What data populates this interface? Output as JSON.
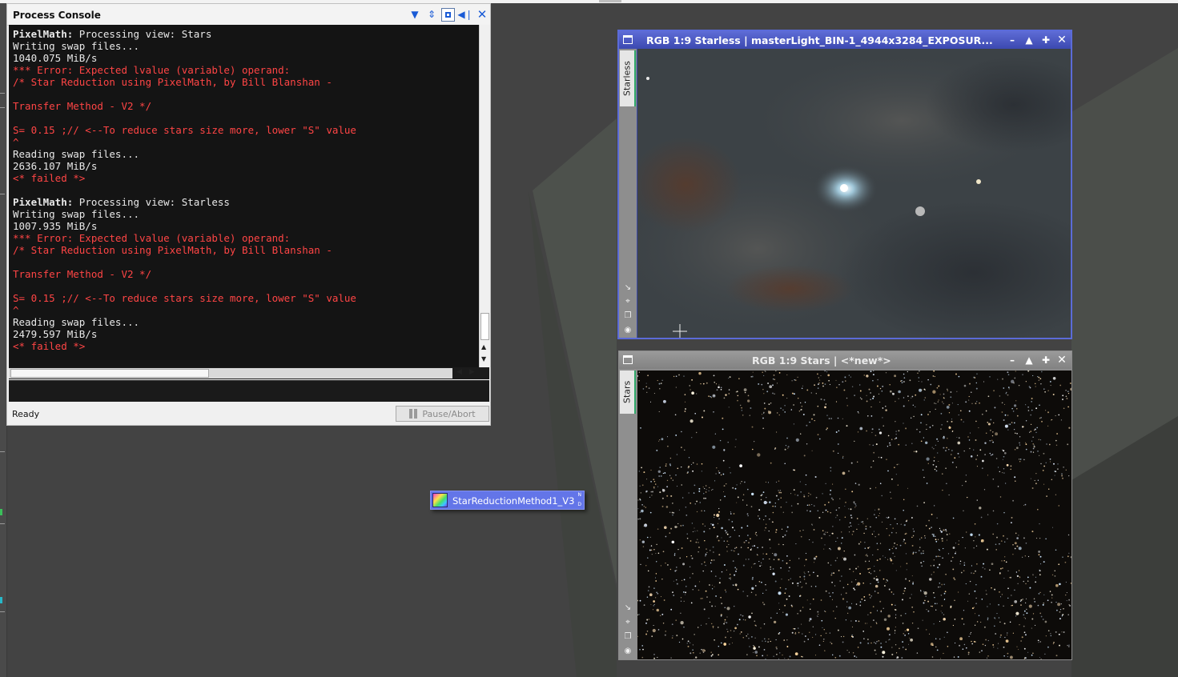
{
  "console": {
    "title": "Process Console",
    "lines": [
      {
        "bold": "PixelMath:",
        "text": " Processing view: Stars",
        "color": "white"
      },
      {
        "bold": "",
        "text": "Writing swap files...",
        "color": "white"
      },
      {
        "bold": "",
        "text": "1040.075 MiB/s",
        "color": "white"
      },
      {
        "bold": "",
        "text": "*** Error: Expected lvalue (variable) operand:",
        "color": "red"
      },
      {
        "bold": "",
        "text": "/* Star Reduction using PixelMath, by Bill Blanshan -",
        "color": "red"
      },
      {
        "bold": "",
        "text": "",
        "color": "red"
      },
      {
        "bold": "",
        "text": "Transfer Method - V2 */",
        "color": "red"
      },
      {
        "bold": "",
        "text": "",
        "color": "red"
      },
      {
        "bold": "",
        "text": "S= 0.15 ;// <--To reduce stars size more, lower \"S\" value",
        "color": "red"
      },
      {
        "bold": "",
        "text": "^",
        "color": "red"
      },
      {
        "bold": "",
        "text": "Reading swap files...",
        "color": "white"
      },
      {
        "bold": "",
        "text": "2636.107 MiB/s",
        "color": "white"
      },
      {
        "bold": "",
        "text": "<* failed *>",
        "color": "red"
      },
      {
        "bold": "",
        "text": "",
        "color": "white"
      },
      {
        "bold": "PixelMath:",
        "text": " Processing view: Starless",
        "color": "white"
      },
      {
        "bold": "",
        "text": "Writing swap files...",
        "color": "white"
      },
      {
        "bold": "",
        "text": "1007.935 MiB/s",
        "color": "white"
      },
      {
        "bold": "",
        "text": "*** Error: Expected lvalue (variable) operand:",
        "color": "red"
      },
      {
        "bold": "",
        "text": "/* Star Reduction using PixelMath, by Bill Blanshan -",
        "color": "red"
      },
      {
        "bold": "",
        "text": "",
        "color": "red"
      },
      {
        "bold": "",
        "text": "Transfer Method - V2 */",
        "color": "red"
      },
      {
        "bold": "",
        "text": "",
        "color": "red"
      },
      {
        "bold": "",
        "text": "S= 0.15 ;// <--To reduce stars size more, lower \"S\" value",
        "color": "red"
      },
      {
        "bold": "",
        "text": "^",
        "color": "red"
      },
      {
        "bold": "",
        "text": "Reading swap files...",
        "color": "white"
      },
      {
        "bold": "",
        "text": "2479.597 MiB/s",
        "color": "white"
      },
      {
        "bold": "",
        "text": "<* failed *>",
        "color": "red"
      }
    ],
    "status": "Ready",
    "pause_abort_label": "Pause/Abort",
    "icons": [
      "chevron-down-icon",
      "resize-vertical-icon",
      "maximize-icon",
      "collapse-left-icon",
      "close-icon"
    ]
  },
  "windows": {
    "starless": {
      "title": "RGB 1:9 Starless | masterLight_BIN-1_4944x3284_EXPOSUR...",
      "tab": "Starless",
      "controls": [
        "minimize-icon",
        "shade-icon",
        "maximize-icon",
        "close-icon"
      ]
    },
    "stars": {
      "title": "RGB 1:9 Stars | <*new*>",
      "tab": "Stars",
      "controls": [
        "minimize-icon",
        "shade-icon",
        "maximize-icon",
        "close-icon"
      ]
    }
  },
  "process_icon": {
    "label": "StarReductionMethod1_V3"
  },
  "colors": {
    "workspace": "#434343",
    "active_title": "#5e6cd6",
    "error_text": "#ff4545",
    "console_bg": "#141414"
  }
}
